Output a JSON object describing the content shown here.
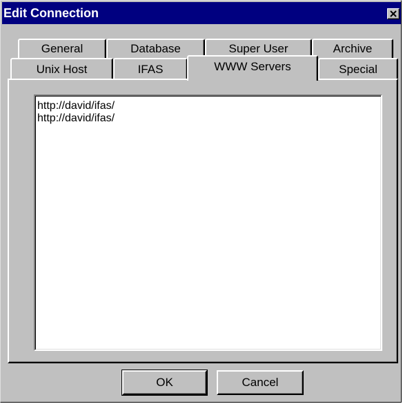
{
  "window": {
    "title": "Edit Connection"
  },
  "tabs": {
    "row_back": [
      {
        "label": "General"
      },
      {
        "label": "Database"
      },
      {
        "label": "Super User"
      },
      {
        "label": "Archive"
      }
    ],
    "row_front": [
      {
        "label": "Unix Host"
      },
      {
        "label": "IFAS"
      },
      {
        "label": "WWW Servers",
        "active": true
      },
      {
        "label": "Special"
      }
    ]
  },
  "servers_list": {
    "items": [
      "http://david/ifas/",
      "http://david/ifas/"
    ]
  },
  "buttons": {
    "ok_label": "OK",
    "cancel_label": "Cancel"
  },
  "colors": {
    "titlebar": "#000080",
    "face": "#c0c0c0"
  }
}
